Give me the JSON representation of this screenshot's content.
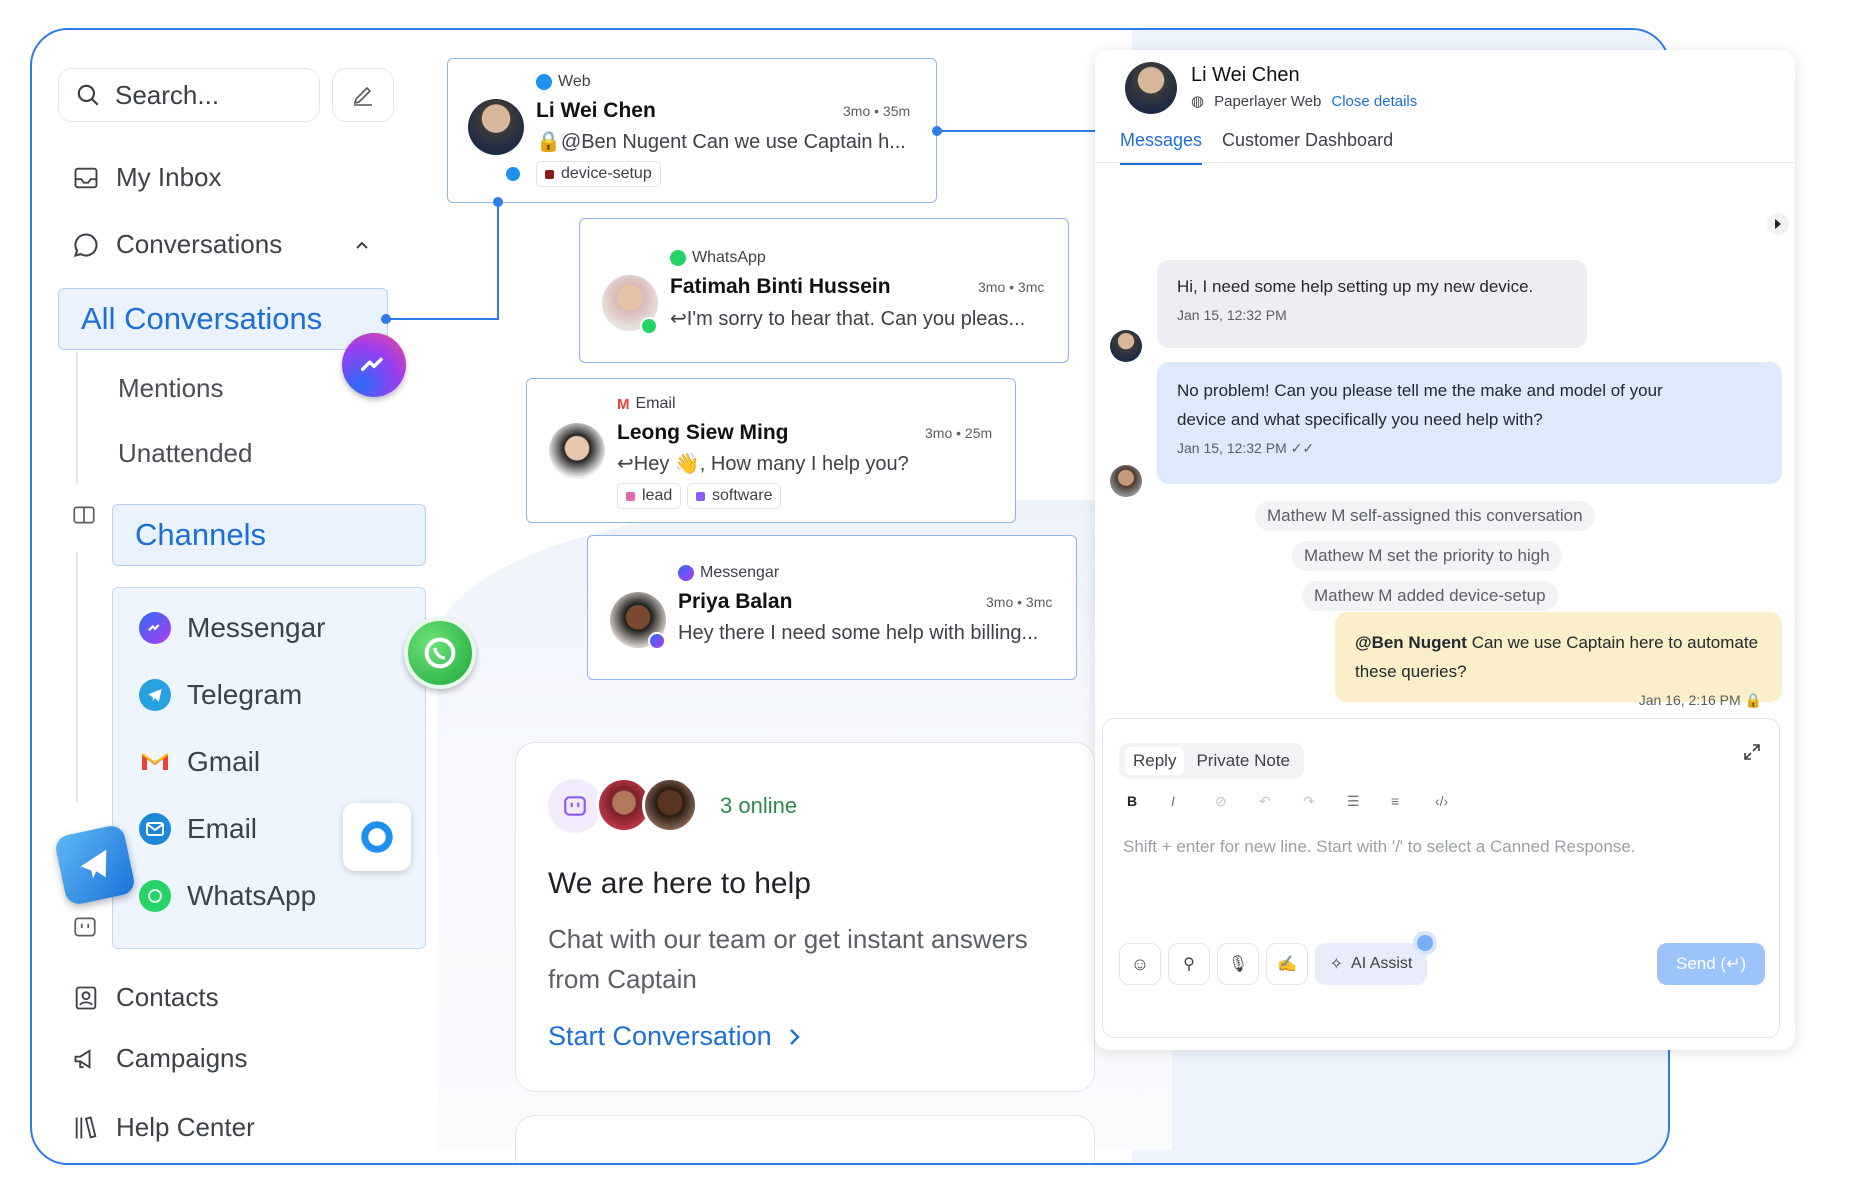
{
  "sidebar": {
    "search_placeholder": "Search...",
    "my_inbox": "My Inbox",
    "conversations": "Conversations",
    "all_conversations": "All Conversations",
    "mentions": "Mentions",
    "unattended": "Unattended",
    "channels": "Channels",
    "channel_items": [
      "Messengar",
      "Telegram",
      "Gmail",
      "Email",
      "WhatsApp"
    ],
    "contacts": "Contacts",
    "campaigns": "Campaigns",
    "help_center": "Help Center"
  },
  "conversations": [
    {
      "channel": "Web",
      "name": "Li Wei Chen",
      "time": "3mo • 35m",
      "preview": "@Ben Nugent Can we use Captain h...",
      "tags": [
        {
          "label": "device-setup",
          "color": "#8b1a1a"
        }
      ]
    },
    {
      "channel": "WhatsApp",
      "name": "Fatimah Binti Hussein",
      "time": "3mo • 3mc",
      "preview": "I'm sorry to hear that. Can you pleas..."
    },
    {
      "channel": "Email",
      "name": "Leong Siew Ming",
      "time": "3mo • 25m",
      "preview": "Hey 👋, How many I help you?",
      "tags": [
        {
          "label": "lead",
          "color": "#e06ab0"
        },
        {
          "label": "software",
          "color": "#8a5cf5"
        }
      ]
    },
    {
      "channel": "Messengar",
      "name": "Priya Balan",
      "time": "3mo • 3mc",
      "preview": "Hey there I need some help with billing..."
    }
  ],
  "help_widget": {
    "online": "3 online",
    "title": "We are here to help",
    "subtitle_line1": "Chat with our team or get instant answers",
    "subtitle_line2": "from Captain",
    "cta": "Start Conversation"
  },
  "panel": {
    "contact_name": "Li Wei Chen",
    "inbox": "Paperlayer Web",
    "close_details": "Close details",
    "tabs": [
      "Messages",
      "Customer Dashboard"
    ],
    "messages": [
      {
        "text": "Hi, I need some help setting up my new device.",
        "time": "Jan 15, 12:32 PM"
      },
      {
        "text_line1": "No problem! Can you please tell me the make and model of your",
        "text_line2": "device and what specifically you need help with?",
        "time": "Jan 15, 12:32 PM"
      }
    ],
    "activities": [
      "Mathew M self-assigned this conversation",
      "Mathew M set the priority to high",
      "Mathew M added device-setup"
    ],
    "private_note": {
      "mention": "@Ben Nugent",
      "text": " Can we use Captain here to automate these queries?",
      "time": "Jan 16, 2:16 PM"
    },
    "reply_tabs": [
      "Reply",
      "Private Note"
    ],
    "editor_placeholder": "Shift + enter for new line. Start with '/' to select a Canned Response.",
    "ai_assist": "AI Assist",
    "send": "Send (↵)"
  }
}
